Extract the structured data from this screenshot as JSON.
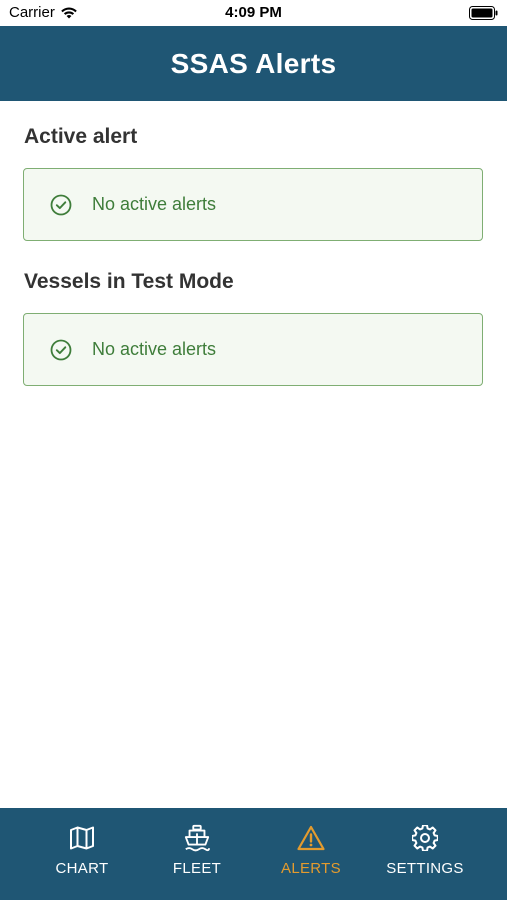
{
  "status_bar": {
    "carrier": "Carrier",
    "time": "4:09 PM"
  },
  "header": {
    "title": "SSAS Alerts"
  },
  "sections": [
    {
      "title": "Active alert",
      "message": "No active alerts"
    },
    {
      "title": "Vessels in Test Mode",
      "message": "No active alerts"
    }
  ],
  "tabs": [
    {
      "label": "CHART",
      "icon": "map-icon",
      "active": false
    },
    {
      "label": "FLEET",
      "icon": "ship-icon",
      "active": false
    },
    {
      "label": "ALERTS",
      "icon": "warning-triangle-icon",
      "active": true
    },
    {
      "label": "SETTINGS",
      "icon": "gear-icon",
      "active": false
    }
  ],
  "colors": {
    "header_bg": "#1f5674",
    "tab_active": "#e39b2e",
    "success_text": "#3e7d3a",
    "success_border": "#7fae73",
    "success_bg": "#f4f9f2"
  }
}
